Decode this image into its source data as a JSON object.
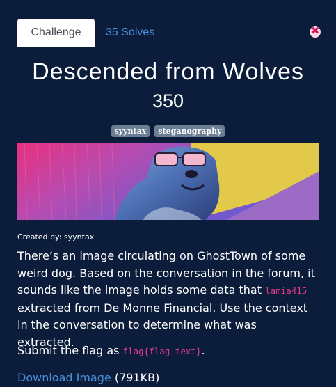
{
  "tabs": {
    "challenge": "Challenge",
    "solves": "35 Solves"
  },
  "close_icon": "close-icon",
  "challenge": {
    "title": "Descended from Wolves",
    "points": "350",
    "tags": [
      "syyntax",
      "steganography"
    ],
    "created_by": "Created by: syyntax",
    "description": {
      "part1": "There’s an image circulating on GhostTown of some weird dog. Based on the conversation in the forum, it sounds like the image holds some data that ",
      "user": "lamia415",
      "part2": " extracted from De Monne Financial. Use the context in the conversation to determine what was extracted."
    },
    "submit": {
      "prefix": "Submit the flag as ",
      "format": "flag{flag-text}",
      "suffix": "."
    },
    "download": {
      "label": "Download Image",
      "size": " (791KB)"
    }
  },
  "colors": {
    "background": "#0b1d3a",
    "link": "#4a8fd9",
    "tag": "#6c7e94",
    "code": "#e6388d"
  }
}
